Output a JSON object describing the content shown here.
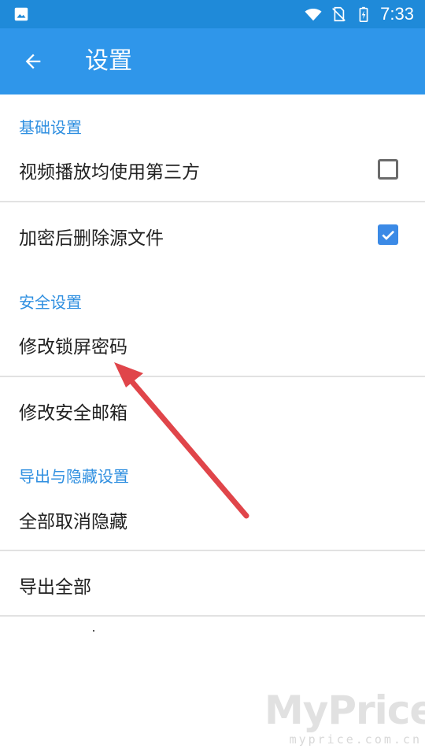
{
  "status_bar": {
    "time": "7:33",
    "icons": [
      "image-icon",
      "wifi-icon",
      "no-sim-icon",
      "battery-charging-icon"
    ]
  },
  "app_bar": {
    "title": "设置",
    "back_icon": "arrow-back-icon"
  },
  "sections": [
    {
      "header": "基础设置",
      "items": [
        {
          "label": "视频播放均使用第三方",
          "checkbox": "unchecked"
        },
        {
          "label": "加密后删除源文件",
          "checkbox": "checked"
        }
      ]
    },
    {
      "header": "安全设置",
      "items": [
        {
          "label": "修改锁屏密码"
        },
        {
          "label": "修改安全邮箱"
        }
      ]
    },
    {
      "header": "导出与隐藏设置",
      "items": [
        {
          "label": "全部取消隐藏"
        },
        {
          "label": "导出全部"
        }
      ]
    }
  ],
  "watermark": {
    "main": "MyPrice",
    "sub": "myprice.com.cn"
  },
  "colors": {
    "status_bar": "#1f8ad9",
    "app_bar": "#2f96ea",
    "section_header": "#2f8fe0",
    "checkbox_checked": "#3b8ae6",
    "annotation_arrow": "#e0454a"
  }
}
